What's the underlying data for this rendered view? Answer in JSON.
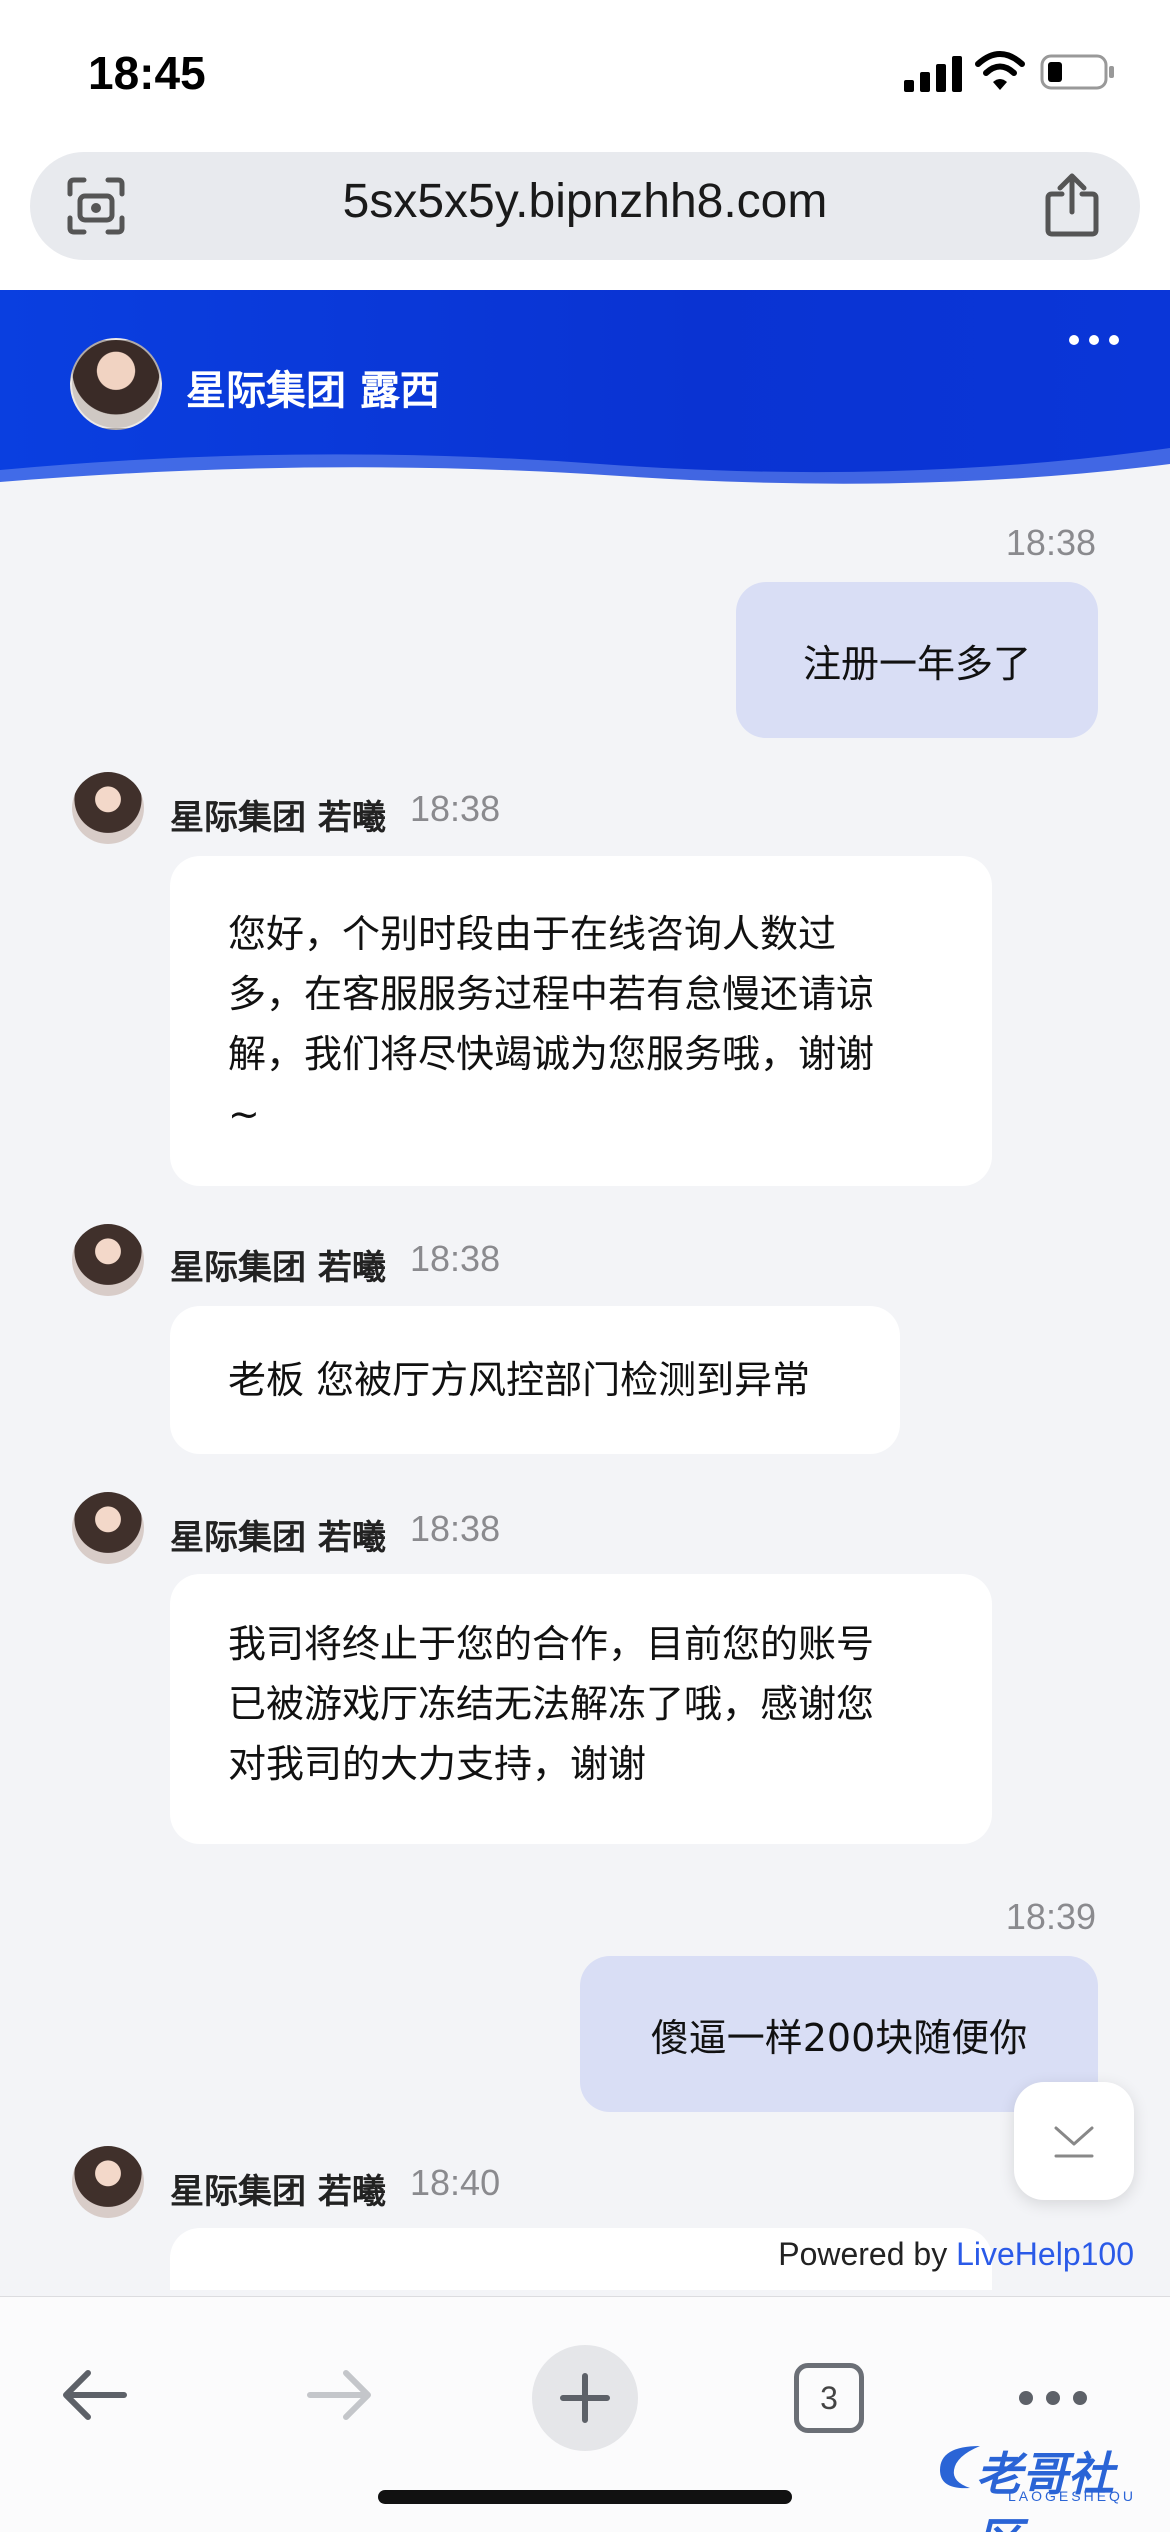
{
  "status_bar": {
    "time": "18:45"
  },
  "address_bar": {
    "url": "5sx5x5y.bipnzhh8.com"
  },
  "chat_header": {
    "title": "星际集团 露西"
  },
  "messages": [
    {
      "direction": "out",
      "time": "18:38",
      "text": "注册一年多了"
    },
    {
      "direction": "in",
      "sender": "星际集团 若曦",
      "time": "18:38",
      "lines": [
        "您好，个别时段由于在线咨询人数过",
        "多，在客服服务过程中若有怠慢还请谅",
        "解，我们将尽快竭诚为您服务哦，谢谢",
        "~"
      ]
    },
    {
      "direction": "in",
      "sender": "星际集团 若曦",
      "time": "18:38",
      "lines": [
        "老板 您被厅方风控部门检测到异常"
      ]
    },
    {
      "direction": "in",
      "sender": "星际集团 若曦",
      "time": "18:38",
      "lines": [
        "我司将终止于您的合作，目前您的账号",
        "已被游戏厅冻结无法解冻了哦，感谢您",
        "对我司的大力支持，谢谢"
      ]
    },
    {
      "direction": "out",
      "time": "18:39",
      "text": "傻逼一样200块随便你"
    },
    {
      "direction": "in",
      "sender": "星际集团 若曦",
      "time": "18:40",
      "lines": []
    }
  ],
  "footer": {
    "powered_prefix": "Powered by ",
    "powered_brand": "LiveHelp100"
  },
  "toolbar": {
    "tab_count": "3"
  },
  "watermark": {
    "text": "老哥社区",
    "sub": "LAOGESHEQU"
  },
  "colors": {
    "header_blue": "#0a3fe0",
    "outgoing_bubble": "#d9def5",
    "brand_link": "#2a5ae8"
  },
  "icons": [
    "signal-icon",
    "wifi-icon",
    "battery-icon",
    "scan-icon",
    "share-icon",
    "more-icon",
    "chevron-down-icon",
    "back-arrow-icon",
    "forward-arrow-icon",
    "plus-icon",
    "tabs-icon",
    "ellipsis-icon"
  ]
}
